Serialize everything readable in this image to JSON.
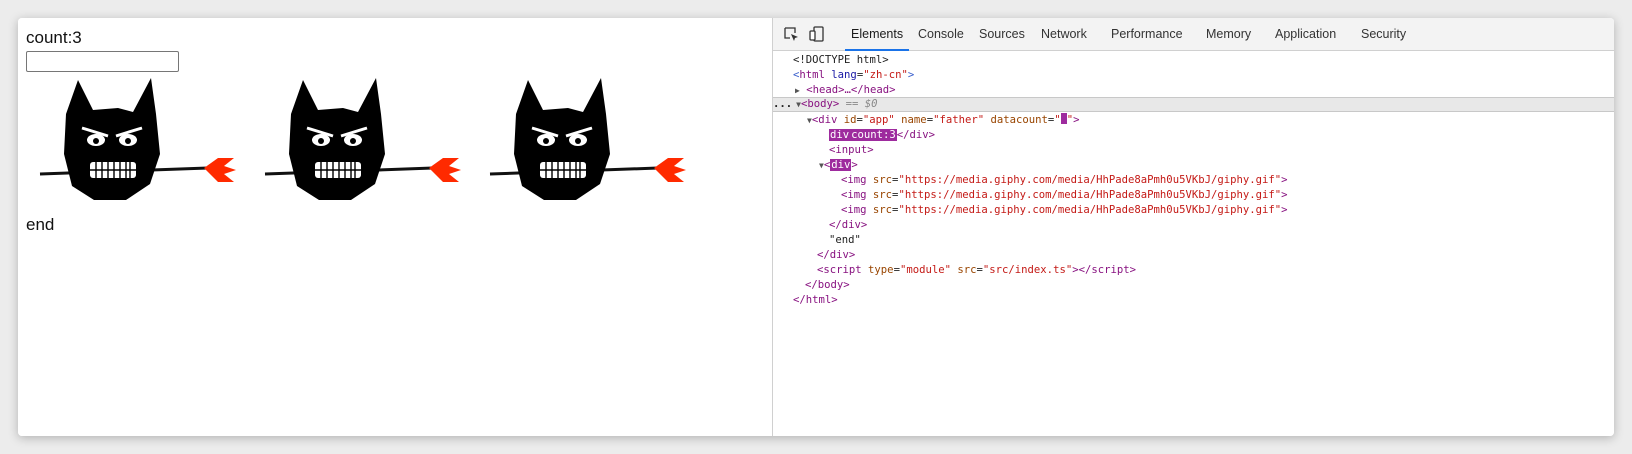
{
  "page": {
    "count_text": "count:3",
    "end_text": "end",
    "gif_count": 3
  },
  "devtools": {
    "icons": [
      "inspect-element-icon",
      "device-toolbar-icon"
    ],
    "tabs": [
      "Elements",
      "Console",
      "Sources",
      "Network",
      "Performance",
      "Memory",
      "Application",
      "Security"
    ],
    "active_tab": "Elements",
    "dom": {
      "doctype": "<!DOCTYPE html>",
      "html_open_tag": "html",
      "html_lang_attr": "lang",
      "html_lang_val": "\"zh-cn\"",
      "head_collapsed": "<head>…</head>",
      "body_tag": "<body>",
      "body_eq": "== $0",
      "app_div": {
        "id_attr": "id",
        "id_val": "\"app\"",
        "name_attr": "name",
        "name_val": "\"father\"",
        "datacount_attr": "datacount"
      },
      "count_div_text": "count:3",
      "input_tag": "<input>",
      "img_src_attr": "src",
      "img_src_val": "\"https://media.giphy.com/media/HhPade8aPmh0u5VKbJ/giphy.gif\"",
      "end_text": "\"end\"",
      "script_type_attr": "type",
      "script_type_val": "\"module\"",
      "script_src_attr": "src",
      "script_src_val": "\"src/index.ts\"",
      "dots": "..."
    }
  },
  "colors": {
    "tag": "#881280",
    "attr": "#994500",
    "value": "#c41a16",
    "highlight": "#9e2b9e",
    "active_tab_underline": "#1a73e8"
  }
}
